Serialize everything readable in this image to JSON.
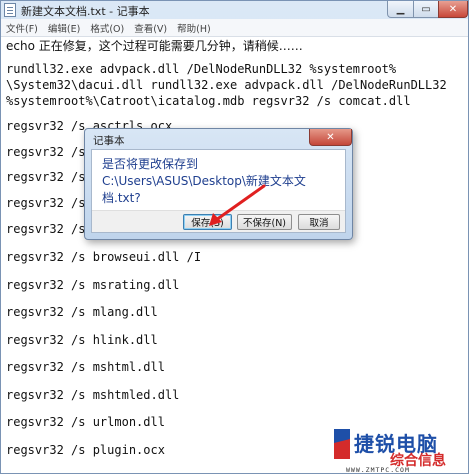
{
  "window": {
    "title": "新建文本文档.txt - 记事本",
    "min_glyph": "▁",
    "max_glyph": "▭",
    "close_glyph": "✕"
  },
  "menu": [
    "文件(F)",
    "编辑(E)",
    "格式(O)",
    "查看(V)",
    "帮助(H)"
  ],
  "editor": {
    "lines": [
      "echo 正在修复，这个过程可能需要几分钟，请稍候……",
      "rundll32.exe advpack.dll /DelNodeRunDLL32 %systemroot%",
      "\\System32\\dacui.dll rundll32.exe advpack.dll /DelNodeRunDLL32",
      "%systemroot%\\Catroot\\icatalog.mdb regsvr32 /s comcat.dll",
      "regsvr32 /s asctrls.ocx",
      "regsvr32 /s",
      "regsvr32 /s",
      "regsvr32 /s",
      "regsvr32 /s",
      "regsvr32 /s browseui.dll /I",
      "regsvr32 /s msrating.dll",
      "regsvr32 /s mlang.dll",
      "regsvr32 /s hlink.dll",
      "regsvr32 /s mshtml.dll",
      "regsvr32 /s mshtmled.dll",
      "regsvr32 /s urlmon.dll",
      "regsvr32 /s plugin.ocx"
    ]
  },
  "dialog": {
    "title": "记事本",
    "close_glyph": "✕",
    "message": "是否将更改保存到 C:\\Users\\ASUS\\Desktop\\新建文本文档.txt?",
    "save_label": "保存(S)",
    "dont_save_label": "不保存(N)",
    "cancel_label": "取消"
  },
  "annotation": {
    "arrow_color": "#e02020"
  },
  "watermark": {
    "brand": "捷锐电脑",
    "sub": "综合信息",
    "url": "WWW.ZMTPC.COM"
  }
}
